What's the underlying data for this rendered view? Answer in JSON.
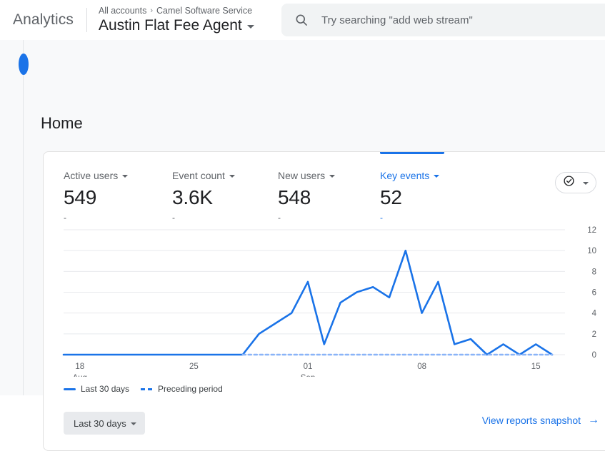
{
  "header": {
    "brand": "Analytics",
    "breadcrumb_root": "All accounts",
    "breadcrumb_sep": "›",
    "breadcrumb_account": "Camel Software Service",
    "property_name": "Austin Flat Fee Agent",
    "property_caret_icon": "chevron-down-icon"
  },
  "search": {
    "placeholder": "Try searching \"add web stream\"",
    "value": "",
    "icon": "search-icon"
  },
  "page": {
    "title": "Home"
  },
  "metrics": [
    {
      "label": "Active users",
      "value": "549",
      "delta": "-",
      "selected": false,
      "caret_icon": "chevron-down-icon"
    },
    {
      "label": "Event count",
      "value": "3.6K",
      "delta": "-",
      "selected": false,
      "caret_icon": "chevron-down-icon"
    },
    {
      "label": "New users",
      "value": "548",
      "delta": "-",
      "selected": false,
      "caret_icon": "chevron-down-icon"
    },
    {
      "label": "Key events",
      "value": "52",
      "delta": "-",
      "selected": true,
      "caret_icon": "chevron-down-icon"
    }
  ],
  "chip": {
    "icon": "check-circle-icon",
    "caret_icon": "chevron-down-icon"
  },
  "legend": [
    {
      "label": "Last 30 days",
      "style": "solid",
      "color": "#1a73e8"
    },
    {
      "label": "Preceding period",
      "style": "dashed",
      "color": "#1a73e8"
    }
  ],
  "footer": {
    "date_range": "Last 30 days",
    "date_range_caret_icon": "chevron-down-icon",
    "view_reports": "View reports snapshot",
    "view_reports_icon": "arrow-right-icon"
  },
  "colors": {
    "accent": "#1a73e8",
    "text_primary": "#202124",
    "text_secondary": "#5f6368",
    "page_bg": "#f8f9fa",
    "card_bg": "#ffffff",
    "border": "#e0e0e0"
  },
  "chart_data": {
    "type": "line",
    "title": "",
    "xlabel": "",
    "ylabel": "",
    "ylim": [
      0,
      12
    ],
    "yticks": [
      0,
      2,
      4,
      6,
      8,
      10,
      12
    ],
    "grid": true,
    "legend_position": "bottom-left",
    "xtick_labels": [
      {
        "day": "18",
        "month": "Aug"
      },
      {
        "day": "25",
        "month": ""
      },
      {
        "day": "01",
        "month": "Sep"
      },
      {
        "day": "08",
        "month": ""
      },
      {
        "day": "15",
        "month": ""
      }
    ],
    "x": [
      "Aug 17",
      "Aug 18",
      "Aug 19",
      "Aug 20",
      "Aug 21",
      "Aug 22",
      "Aug 23",
      "Aug 24",
      "Aug 25",
      "Aug 26",
      "Aug 27",
      "Aug 28",
      "Aug 29",
      "Aug 30",
      "Aug 31",
      "Sep 01",
      "Sep 02",
      "Sep 03",
      "Sep 04",
      "Sep 05",
      "Sep 06",
      "Sep 07",
      "Sep 08",
      "Sep 09",
      "Sep 10",
      "Sep 11",
      "Sep 12",
      "Sep 13",
      "Sep 14",
      "Sep 15"
    ],
    "series": [
      {
        "name": "Last 30 days",
        "style": "solid",
        "color": "#1a73e8",
        "values": [
          0,
          0,
          0,
          0,
          0,
          0,
          0,
          0,
          0,
          0,
          0,
          0,
          2,
          3,
          4,
          7,
          1,
          5,
          6,
          6.5,
          5.5,
          10,
          4,
          7,
          1,
          1.5,
          0,
          1,
          0,
          1,
          0
        ]
      },
      {
        "name": "Preceding period",
        "style": "dashed",
        "color": "#8ab4f8",
        "values": [
          null,
          null,
          null,
          null,
          null,
          null,
          null,
          null,
          null,
          null,
          null,
          0,
          0,
          0,
          0,
          0,
          0,
          0,
          0,
          0,
          0,
          0,
          0,
          0,
          0,
          0,
          0,
          0,
          0,
          0,
          0
        ]
      }
    ]
  }
}
